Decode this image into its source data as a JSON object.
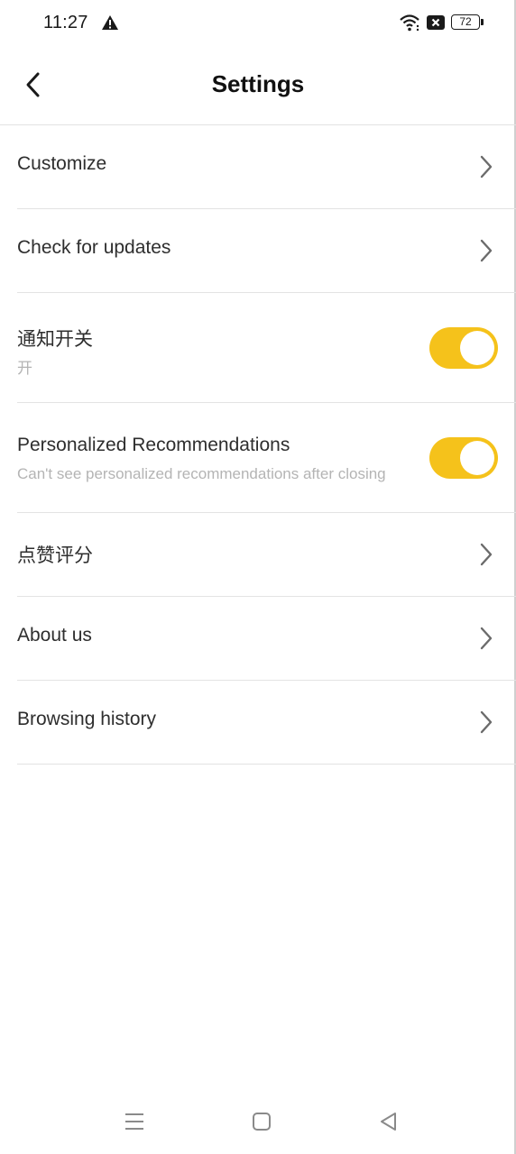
{
  "status_bar": {
    "time": "11:27",
    "battery": "72",
    "icons": [
      "warning-icon",
      "wifi-icon",
      "no-sim-icon",
      "battery-icon"
    ]
  },
  "header": {
    "title": "Settings",
    "back_icon": "chevron-left-icon"
  },
  "settings": {
    "items": [
      {
        "label": "Customize",
        "control": "chevron"
      },
      {
        "label": "Check for updates",
        "control": "chevron"
      },
      {
        "label": "通知开关",
        "sublabel": "开",
        "control": "toggle",
        "on": true
      },
      {
        "label": "Personalized Recommendations",
        "sublabel": "Can't see personalized recommendations after closing",
        "control": "toggle",
        "on": true
      },
      {
        "label": "点赞评分",
        "control": "chevron"
      },
      {
        "label": "About us",
        "control": "chevron"
      },
      {
        "label": "Browsing history",
        "control": "chevron"
      }
    ]
  },
  "nav_bar": {
    "icons": [
      "menu-icon",
      "home-icon",
      "back-triangle-icon"
    ]
  },
  "colors": {
    "accent": "#f5c21b",
    "text": "#2e2e2e",
    "subtext": "#b4b4b4",
    "divider": "#e3e3e3"
  }
}
